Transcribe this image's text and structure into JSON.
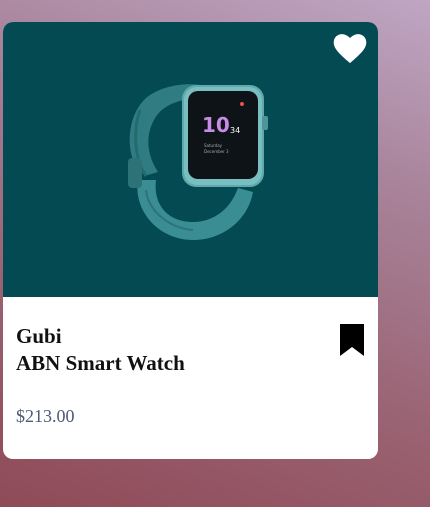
{
  "product": {
    "brand": "Gubi",
    "name": "ABN Smart Watch",
    "price": "$213.00",
    "image_description_icon": "smartwatch-image",
    "watch_face": {
      "time_hour": "10",
      "time_min": "34",
      "day": "Saturday",
      "date": "December 3"
    }
  },
  "icons": {
    "favorite": "heart-icon",
    "save": "bookmark-icon"
  },
  "colors": {
    "media_background": "#034a52",
    "watch_teal": "#3a8d92",
    "price_text": "#4b5a78"
  }
}
